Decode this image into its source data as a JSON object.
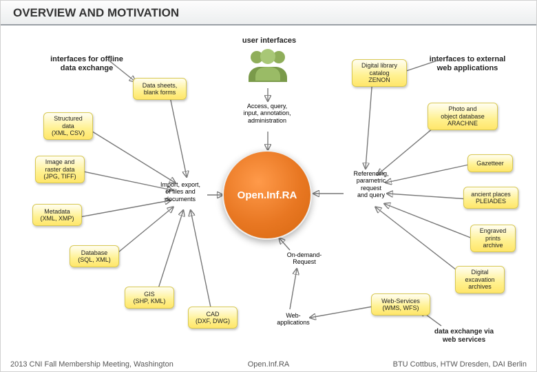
{
  "title": "OVERVIEW AND MOTIVATION",
  "headings": {
    "user_interfaces": "user interfaces",
    "offline": "interfaces for offline\ndata exchange",
    "external": "interfaces to external\nweb applications",
    "webservices": "data exchange via\nweb services"
  },
  "center": "Open.Inf.RA",
  "labels": {
    "access": "Access, query,\ninput, annotation,\nadministration",
    "importexport": "Import, export,\nof files and\ndocuments",
    "ondemand": "On-demand-\nRequest",
    "webapps": "Web-\napplications",
    "referencing": "Referencing,\nparametric\nrequest\nand query"
  },
  "nodes": {
    "datasheets": "Data sheets,\nblank forms",
    "structured": "Structured\ndata\n(XML, CSV)",
    "image": "Image and\nraster data\n(JPG, TIFF)",
    "metadata": "Metadata\n(XML, XMP)",
    "database": "Database\n(SQL, XML)",
    "gis": "GIS\n(SHP, KML)",
    "cad": "CAD\n(DXF, DWG)",
    "zenon": "Digital library\ncatalog\nZENON",
    "arachne": "Photo and\nobject database\nARACHNE",
    "gazetteer": "Gazetteer",
    "pleiades": "ancient places\nPLEIADES",
    "engraved": "Engraved\nprints\narchive",
    "excavation": "Digital\nexcavation\narchives",
    "wms": "Web-Services\n(WMS, WFS)"
  },
  "footer": {
    "left": "2013 CNI Fall Membership Meeting, Washington",
    "center": "Open.Inf.RA",
    "right": "BTU Cottbus, HTW Dresden, DAI Berlin"
  }
}
